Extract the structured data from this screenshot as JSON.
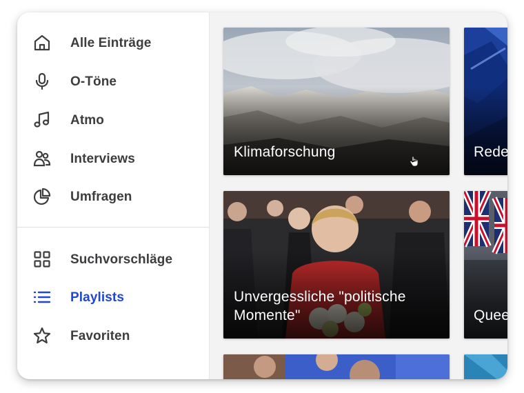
{
  "sidebar": {
    "items": [
      {
        "label": "Alle Einträge",
        "icon": "home-icon"
      },
      {
        "label": "O-Töne",
        "icon": "microphone-icon"
      },
      {
        "label": "Atmo",
        "icon": "music-note-icon"
      },
      {
        "label": "Interviews",
        "icon": "users-icon"
      },
      {
        "label": "Umfragen",
        "icon": "pie-chart-icon"
      },
      {
        "label": "Suchvorschläge",
        "icon": "grid-icon"
      },
      {
        "label": "Playlists",
        "icon": "list-icon",
        "active": true
      },
      {
        "label": "Favoriten",
        "icon": "star-icon"
      }
    ]
  },
  "cards": [
    {
      "title": "Klimaforschung"
    },
    {
      "title": "Rede Parla"
    },
    {
      "title": "Unvergessliche \"politische Momente\""
    },
    {
      "title": "Quee britis"
    }
  ],
  "colors": {
    "accent": "#1f46d6",
    "nav_text": "#3d3d40",
    "icon": "#3d3d40"
  }
}
